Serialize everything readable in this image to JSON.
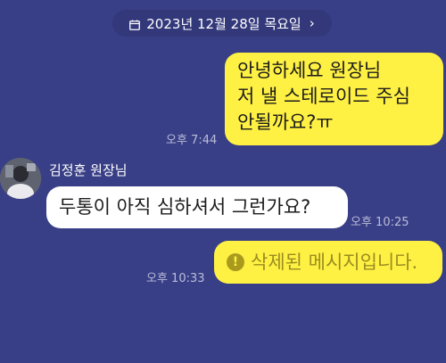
{
  "date_header": {
    "label": "2023년 12월 28일 목요일",
    "icon": "calendar-icon",
    "chevron": "chevron-right-icon"
  },
  "messages": [
    {
      "side": "me",
      "lines": [
        "안녕하세요 원장님",
        "저 낼 스테로이드 주심",
        "안될까요?ㅠ"
      ],
      "time": "오후 7:44"
    },
    {
      "side": "other",
      "sender": "김정훈 원장님",
      "text": "두통이 아직 심하셔서 그런가요?",
      "time": "오후 10:25"
    },
    {
      "side": "me",
      "deleted": true,
      "icon": "warning-icon",
      "text": "삭제된 메시지입니다.",
      "time": "오후 10:33"
    }
  ],
  "colors": {
    "background": "#393f86",
    "my_bubble": "#fff143",
    "other_bubble": "#ffffff",
    "timestamp": "#b9bdd9"
  }
}
